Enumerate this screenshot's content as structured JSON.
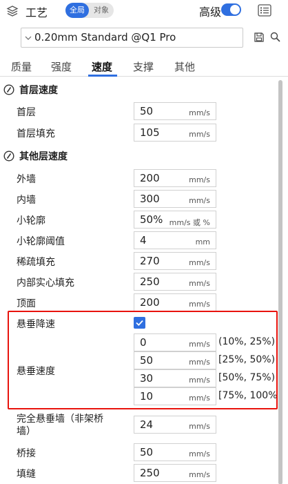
{
  "header": {
    "title": "工艺",
    "scope_global": "全局",
    "scope_object": "对象",
    "advanced_label": "高级",
    "advanced_on": true
  },
  "preset": {
    "name": "0.20mm Standard @Q1 Pro"
  },
  "tabs": [
    {
      "label": "质量",
      "active": false
    },
    {
      "label": "强度",
      "active": false
    },
    {
      "label": "速度",
      "active": true
    },
    {
      "label": "支撑",
      "active": false
    },
    {
      "label": "其他",
      "active": false
    }
  ],
  "sections": {
    "first_layer": {
      "title": "首层速度",
      "rows": [
        {
          "label": "首层",
          "value": "50",
          "unit": "mm/s"
        },
        {
          "label": "首层填充",
          "value": "105",
          "unit": "mm/s"
        }
      ]
    },
    "other_layers": {
      "title": "其他层速度",
      "rows": [
        {
          "label": "外墙",
          "value": "200",
          "unit": "mm/s"
        },
        {
          "label": "内墙",
          "value": "300",
          "unit": "mm/s"
        },
        {
          "label": "小轮廓",
          "value": "50%",
          "unit": "mm/s 或 %"
        },
        {
          "label": "小轮廓阈值",
          "value": "4",
          "unit": "mm"
        },
        {
          "label": "稀疏填充",
          "value": "270",
          "unit": "mm/s"
        },
        {
          "label": "内部实心填充",
          "value": "250",
          "unit": "mm/s"
        },
        {
          "label": "顶面",
          "value": "200",
          "unit": "mm/s"
        }
      ],
      "overhang_slowdown": {
        "label": "悬垂降速",
        "checked": true
      },
      "overhang_speed": {
        "label": "悬垂速度",
        "rows": [
          {
            "value": "0",
            "unit": "mm/s",
            "range": "(10%, 25%)"
          },
          {
            "value": "50",
            "unit": "mm/s",
            "range": "[25%, 50%)"
          },
          {
            "value": "30",
            "unit": "mm/s",
            "range": "[50%, 75%)"
          },
          {
            "value": "10",
            "unit": "mm/s",
            "range": "[75%, 100%"
          }
        ]
      },
      "rows_after": [
        {
          "label": "完全悬垂墙（非架桥",
          "label_line2": "墙）",
          "value": "24",
          "unit": "mm/s"
        },
        {
          "label": "桥接",
          "value": "50",
          "unit": "mm/s"
        },
        {
          "label": "填缝",
          "value": "250",
          "unit": "mm/s"
        }
      ]
    }
  },
  "colors": {
    "accent": "#2f6fe0",
    "highlight_box": "#e8120c"
  }
}
